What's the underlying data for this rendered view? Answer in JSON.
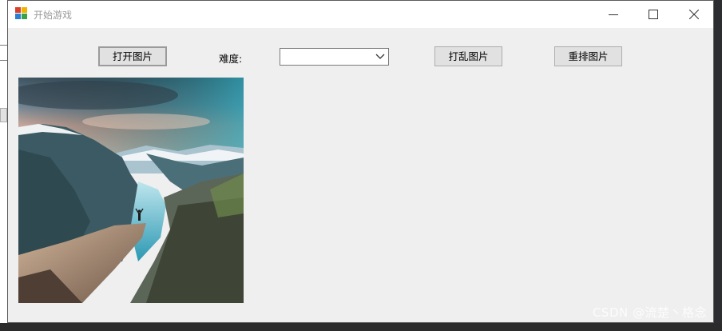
{
  "window": {
    "title": "开始游戏"
  },
  "toolbar": {
    "open_image_label": "打开图片",
    "difficulty_label": "难度:",
    "difficulty_value": "",
    "shuffle_label": "打乱图片",
    "reorder_label": "重排图片"
  },
  "watermark": "CSDN @流楚丶格念",
  "icons": {
    "app": "app-icon",
    "minimize": "minimize-icon",
    "maximize": "maximize-icon",
    "close": "close-icon",
    "dropdown": "chevron-down-icon"
  },
  "colors": {
    "window_bg": "#efefef",
    "button_bg": "#e1e1e1",
    "title_text": "#9a9a9a"
  }
}
